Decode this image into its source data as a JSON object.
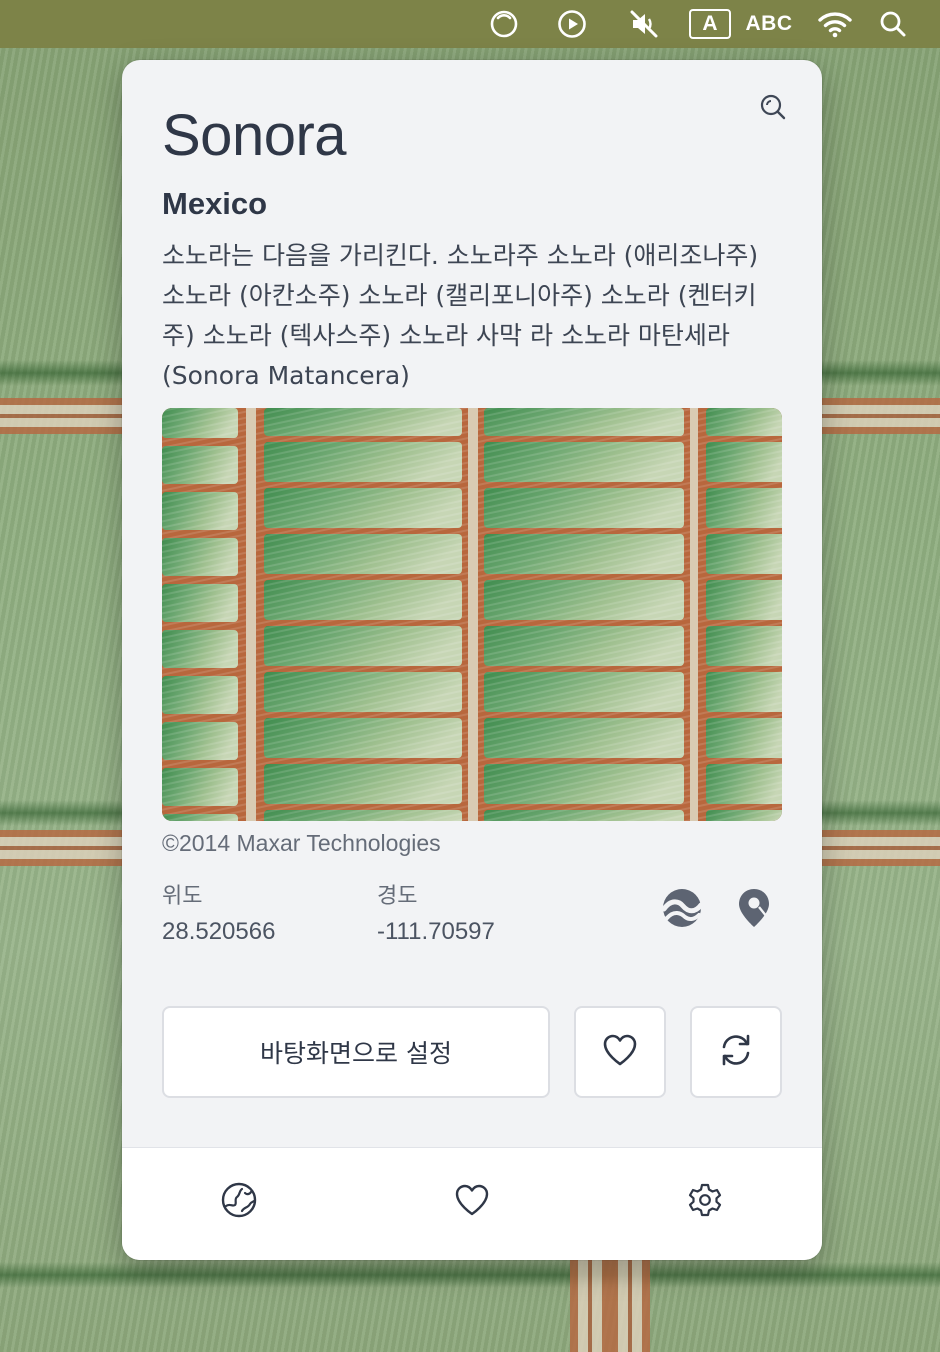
{
  "menubar": {
    "icons": [
      "spinner-icon",
      "play-circle-icon",
      "mute-icon",
      "input-source-a-icon",
      "wifi-icon",
      "spotlight-search-icon"
    ],
    "input_letter": "A",
    "input_source_label": "ABC"
  },
  "place": {
    "name": "Sonora",
    "country": "Mexico",
    "description": "소노라는 다음을 가리킨다. 소노라주 소노라 (애리조나주) 소노라 (아칸소주) 소노라 (캘리포니아주) 소노라 (켄터키주) 소노라 (텍사스주) 소노라 사막 라 소노라 마탄세라(Sonora Matancera)",
    "copyright": "©2014 Maxar Technologies"
  },
  "coordinates": {
    "latitude_label": "위도",
    "latitude_value": "28.520566",
    "longitude_label": "경도",
    "longitude_value": "-111.70597"
  },
  "actions": {
    "set_wallpaper_label": "바탕화면으로 설정",
    "icons": [
      "heart-icon",
      "refresh-icon",
      "google-earth-icon",
      "map-pin-icon",
      "search-zoom-icon"
    ]
  },
  "tabs": [
    {
      "icon": "globe-icon"
    },
    {
      "icon": "heart-icon"
    },
    {
      "icon": "gear-icon"
    }
  ],
  "colors": {
    "menubar": "#7d8348",
    "card_bg": "#f2f3f5",
    "text_primary": "#2f3747",
    "text_secondary": "#656c78"
  }
}
